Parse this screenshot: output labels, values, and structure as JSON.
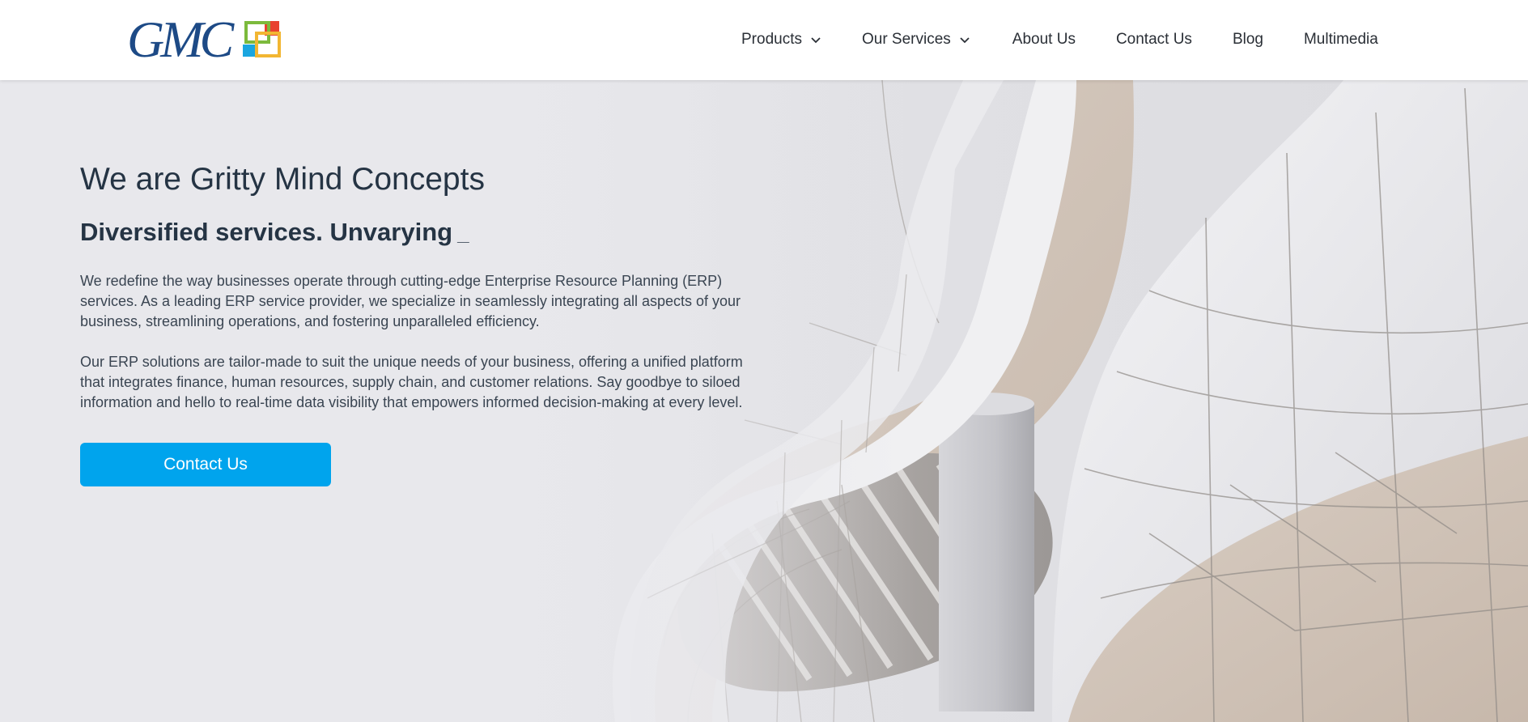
{
  "brand": {
    "logo_text": "GMC",
    "logo_colors": [
      "#e8422f",
      "#7cba3c",
      "#f2b632",
      "#1aa6e0"
    ]
  },
  "nav": {
    "items": [
      {
        "label": "Products",
        "has_dropdown": true
      },
      {
        "label": "Our Services",
        "has_dropdown": true
      },
      {
        "label": "About Us",
        "has_dropdown": false
      },
      {
        "label": "Contact Us",
        "has_dropdown": false
      },
      {
        "label": "Blog",
        "has_dropdown": false
      },
      {
        "label": "Multimedia",
        "has_dropdown": false
      }
    ]
  },
  "hero": {
    "title": "We are Gritty Mind Concepts",
    "subtitle": "Diversified services. Unvarying",
    "typing_cursor": "_",
    "paragraph1": "We redefine the way businesses operate through cutting-edge Enterprise Resource Planning (ERP) services. As a leading ERP service provider, we specialize in seamlessly integrating all aspects of your business, streamlining operations, and fostering unparalleled efficiency.",
    "paragraph2": "Our ERP solutions are tailor-made to suit the unique needs of your business, offering a unified platform that integrates finance, human resources, supply chain, and customer relations. Say goodbye to siloed information and hello to real-time data visibility that empowers informed decision-making at every level.",
    "cta_label": "Contact Us"
  },
  "colors": {
    "accent": "#00a4ed",
    "heading": "#253444",
    "text": "#3a4552",
    "logo_blue": "#1d4a86"
  },
  "icons": [
    "chevron-down-icon",
    "gmc-logo-mark-icon"
  ]
}
